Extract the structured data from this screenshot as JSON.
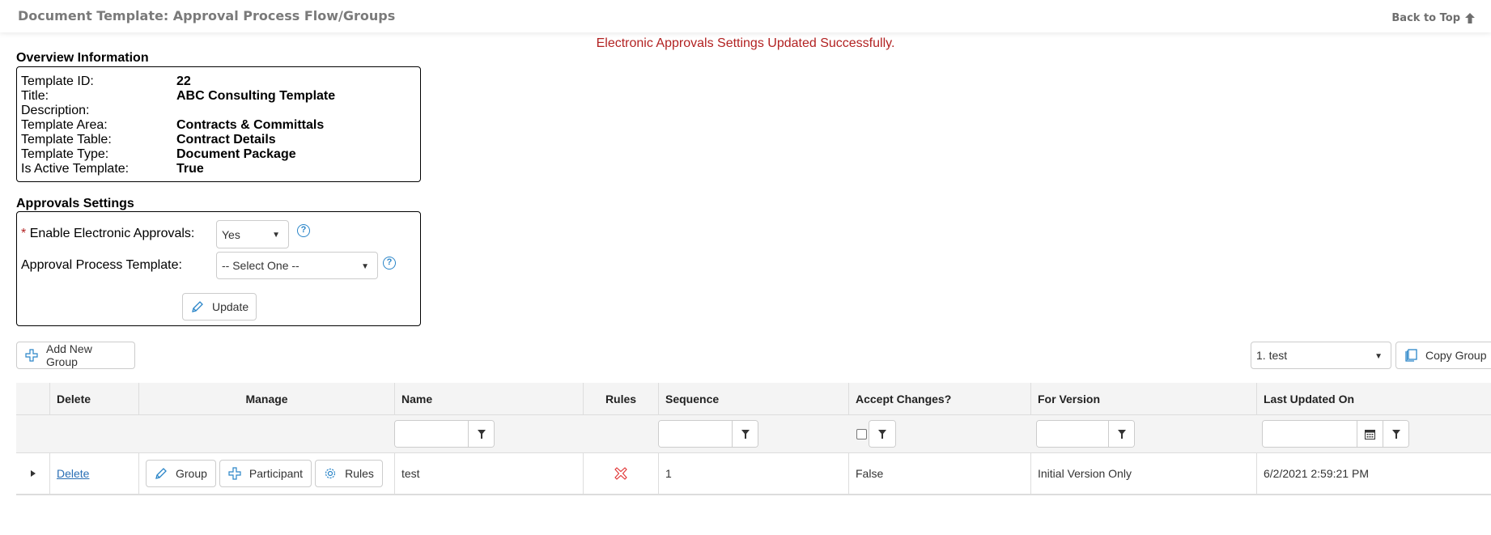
{
  "header": {
    "title": "Document Template: Approval Process Flow/Groups",
    "back_to_top": "Back to Top"
  },
  "message": {
    "text": "Electronic Approvals Settings Updated Successfully.",
    "color": "#b22222"
  },
  "overview": {
    "title": "Overview Information",
    "rows": [
      {
        "label": "Template ID:",
        "value": "22"
      },
      {
        "label": "Title:",
        "value": "ABC Consulting Template"
      },
      {
        "label": "Description:",
        "value": ""
      },
      {
        "label": "Template Area:",
        "value": "Contracts & Committals"
      },
      {
        "label": "Template Table:",
        "value": "Contract Details"
      },
      {
        "label": "Template Type:",
        "value": "Document Package"
      },
      {
        "label": "Is Active Template:",
        "value": "True"
      }
    ]
  },
  "approvals": {
    "title": "Approvals Settings",
    "required_mark": "*",
    "enable_label": "Enable Electronic Approvals:",
    "enable_value": "Yes",
    "template_label": "Approval Process Template:",
    "template_value": "-- Select One --",
    "update_button": "Update"
  },
  "toolbar": {
    "add_group_button": "Add New Group",
    "copy_select_value": "1. test",
    "copy_group_button": "Copy Group"
  },
  "grid": {
    "columns": [
      "",
      "Delete",
      "Manage",
      "Name",
      "Rules",
      "Sequence",
      "Accept Changes?",
      "For Version",
      "Last Updated On"
    ],
    "rows": [
      {
        "delete_link": "Delete",
        "manage_buttons": [
          "Group",
          "Participant",
          "Rules"
        ],
        "name": "test",
        "rules_icon": "red-x-icon",
        "sequence": "1",
        "accept_changes": "False",
        "for_version": "Initial Version Only",
        "last_updated_on": "6/2/2021 2:59:21 PM"
      }
    ]
  },
  "colors": {
    "accent_blue": "#2a85c8",
    "link_blue": "#2a6fb5",
    "error_red": "#b22222",
    "header_gray": "#7a7a7a"
  }
}
